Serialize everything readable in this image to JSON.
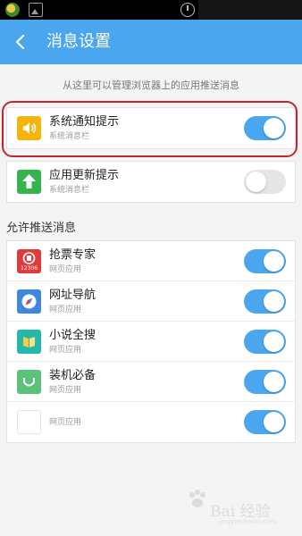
{
  "header": {
    "title": "消息设置"
  },
  "intro_text": "从这里可以管理浏览器上的应用推送消息",
  "top_settings": [
    {
      "title": "系统通知提示",
      "subtitle": "系统消息栏",
      "icon": "speaker-icon",
      "color": "#f5b40a",
      "enabled": true
    },
    {
      "title": "应用更新提示",
      "subtitle": "系统消息栏",
      "icon": "up-arrow-icon",
      "color": "#34b44a",
      "enabled": false
    }
  ],
  "section_title": "允许推送消息",
  "apps": [
    {
      "title": "抢票专家",
      "subtitle": "网页应用",
      "icon": "train-ticket-icon",
      "icon_label": "12306",
      "color": "#e23a3a",
      "enabled": true
    },
    {
      "title": "网址导航",
      "subtitle": "网页应用",
      "icon": "compass-icon",
      "color": "#3f86e0",
      "enabled": true
    },
    {
      "title": "小说全搜",
      "subtitle": "网页应用",
      "icon": "book-icon",
      "color": "#25b7a8",
      "enabled": true
    },
    {
      "title": "装机必备",
      "subtitle": "网页应用",
      "icon": "install-icon",
      "color": "#5bc27a",
      "enabled": true
    },
    {
      "title": "",
      "subtitle": "网页应用",
      "icon": "blank-app-icon",
      "color": "#ffffff",
      "enabled": true
    }
  ],
  "watermark": {
    "text": "Bai 经验",
    "url": "jingyan.baidu.com"
  },
  "accent_color": "#4aa6ef"
}
